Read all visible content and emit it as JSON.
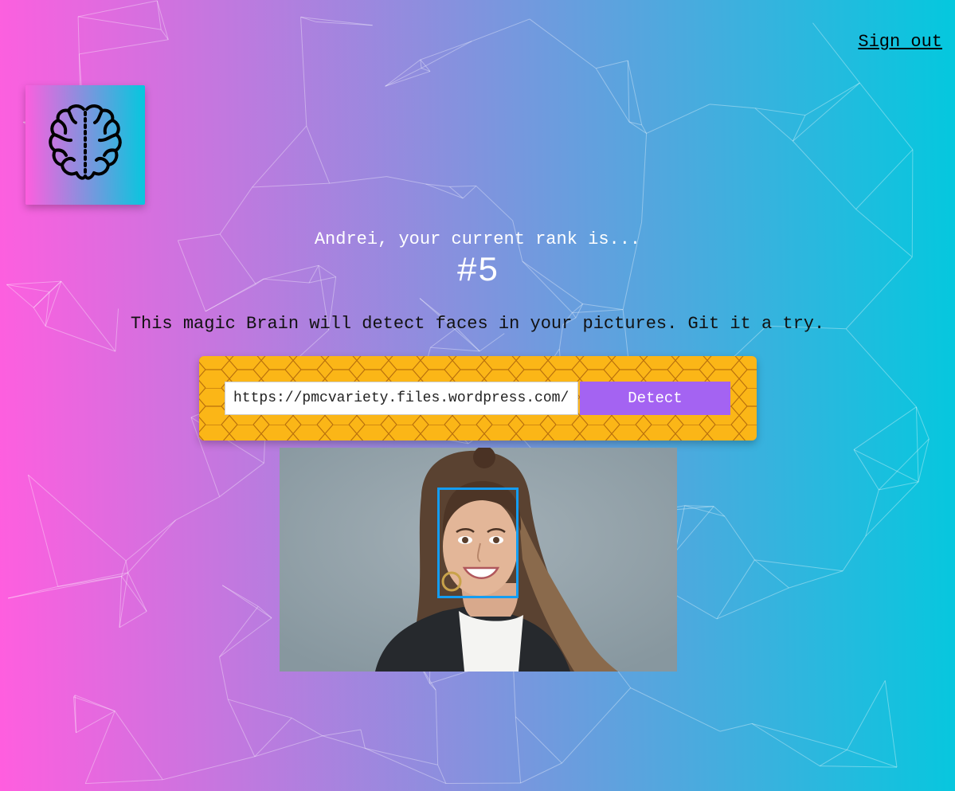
{
  "nav": {
    "sign_out_label": "Sign out"
  },
  "logo": {
    "icon": "brain-icon"
  },
  "rank": {
    "message": "Andrei, your current rank is...",
    "value": "#5"
  },
  "tagline": "This magic Brain will detect faces in your pictures. Git it a try.",
  "form": {
    "url_value": "https://pmcvariety.files.wordpress.com/",
    "detect_label": "Detect"
  },
  "image": {
    "alt": "Woman smiling portrait with detected face"
  },
  "colors": {
    "gradient_start": "#ff5edf",
    "gradient_end": "#04c8de",
    "form_background": "#fbb617",
    "button": "#a463f2",
    "face_box": "#149df2"
  }
}
